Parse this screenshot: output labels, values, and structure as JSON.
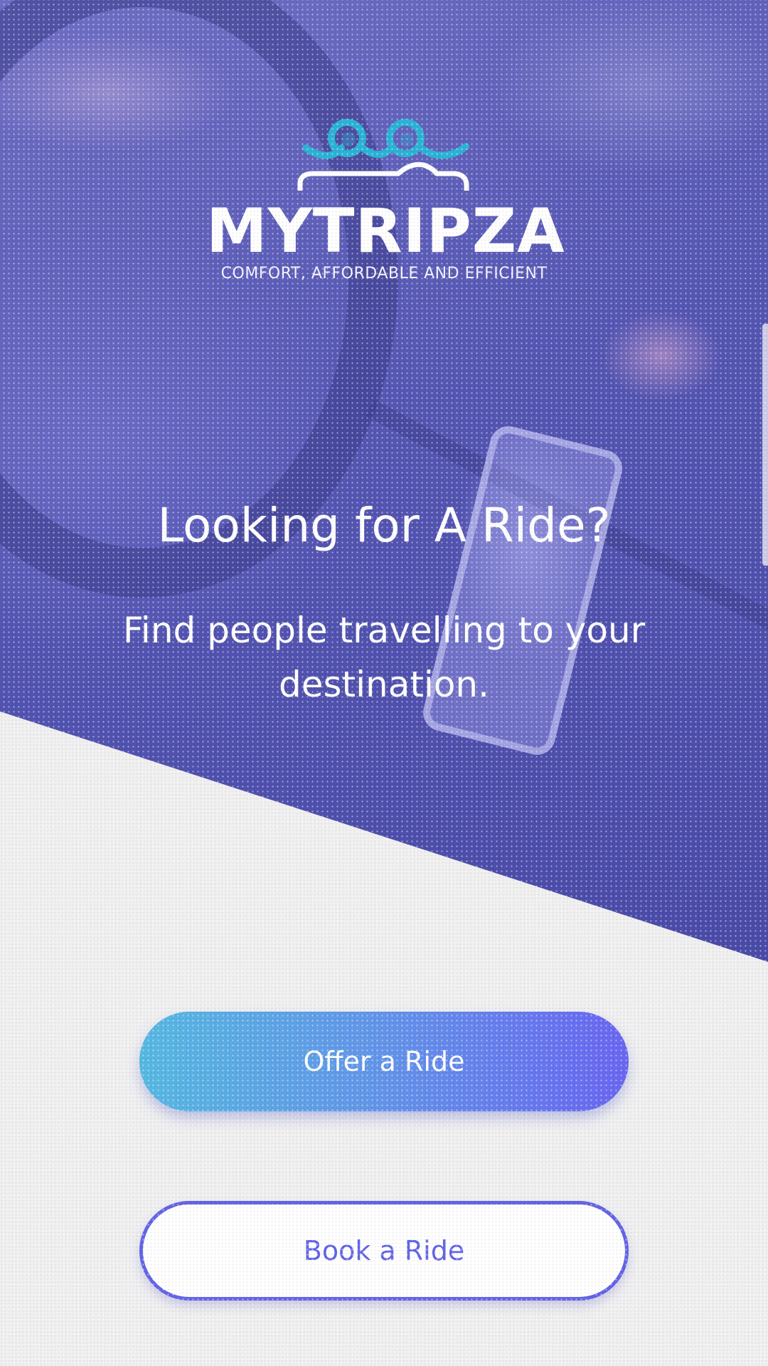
{
  "brand": {
    "name": "MYTRIPZA",
    "tagline": "COMFORT, AFFORDABLE AND EFFICIENT",
    "logo_icon": "car-with-passengers-logo-icon"
  },
  "hero": {
    "title": "Looking for A Ride?",
    "subtitle": "Find people travelling to your destination."
  },
  "actions": {
    "offer_label": "Offer a Ride",
    "book_label": "Book a Ride"
  },
  "colors": {
    "hero_overlay": "#5556b3",
    "accent": "#6364e6",
    "gradient_start": "#56b9e2",
    "gradient_end": "#6a66f2",
    "logo_teal": "#2bb3d6"
  }
}
